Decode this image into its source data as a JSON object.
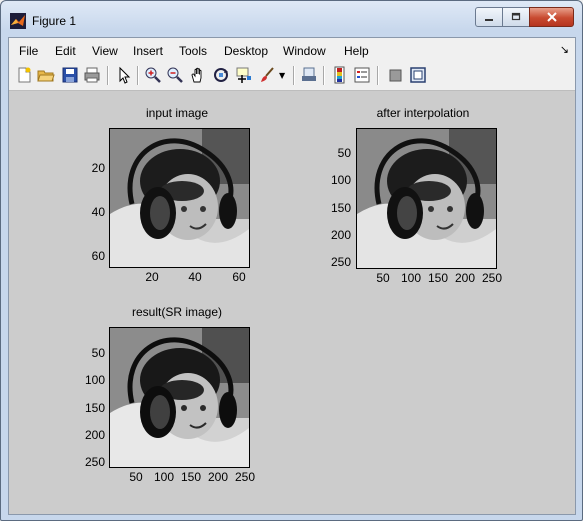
{
  "window": {
    "title": "Figure 1"
  },
  "menu": {
    "items": [
      "File",
      "Edit",
      "View",
      "Insert",
      "Tools",
      "Desktop",
      "Window",
      "Help"
    ]
  },
  "toolbar": {
    "icons": [
      "new-figure-icon",
      "open-file-icon",
      "save-icon",
      "print-icon",
      "pointer-icon",
      "zoom-in-icon",
      "zoom-out-icon",
      "pan-icon",
      "rotate-3d-icon",
      "data-cursor-icon",
      "brush-icon",
      "link-icon",
      "colorbar-icon",
      "legend-icon",
      "hide-plot-tools-icon",
      "show-plot-tools-icon"
    ]
  },
  "axes": [
    {
      "title": "input image",
      "yticks": [
        "20",
        "40",
        "60"
      ],
      "xticks": [
        "20",
        "40",
        "60"
      ]
    },
    {
      "title": "after interpolation",
      "yticks": [
        "50",
        "100",
        "150",
        "200",
        "250"
      ],
      "xticks": [
        "50",
        "100",
        "150",
        "200",
        "250"
      ]
    },
    {
      "title": "result(SR image)",
      "yticks": [
        "50",
        "100",
        "150",
        "200",
        "250"
      ],
      "xticks": [
        "50",
        "100",
        "150",
        "200",
        "250"
      ]
    }
  ]
}
